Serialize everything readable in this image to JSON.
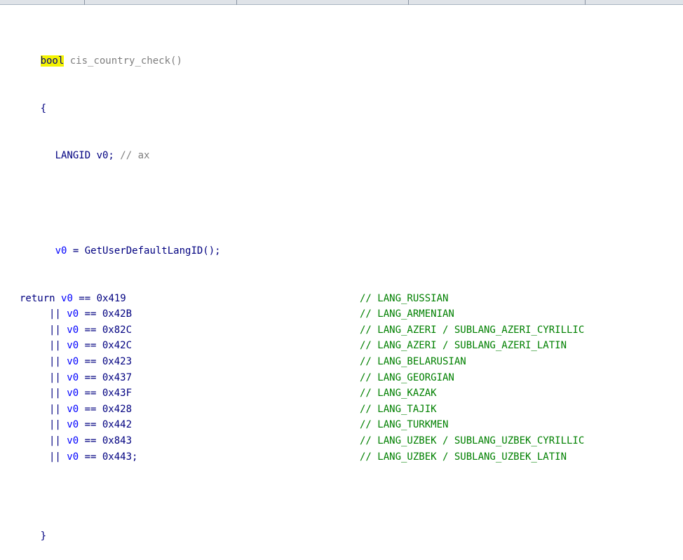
{
  "colors": {
    "code_text": "#000080",
    "comment": "#008000",
    "variable": "#0000ff",
    "signature": "#7f7f7f",
    "highlight": "#f3f300",
    "tab_strip": "#dfe3e8"
  },
  "code": {
    "sig_kw": "bool",
    "sig_rest": " cis_country_check()",
    "open_brace": "{",
    "decl_type": "LANGID v0;",
    "decl_comment": " // ax",
    "assign_var": "v0",
    "assign_rest": " = GetUserDefaultLangID();",
    "ret_kw": "return ",
    "or_op": "||",
    "close_brace": "}",
    "lines": [
      {
        "var": "v0",
        "val": "0x419",
        "comment": "// LANG_RUSSIAN"
      },
      {
        "var": "v0",
        "val": "0x42B",
        "comment": "// LANG_ARMENIAN"
      },
      {
        "var": "v0",
        "val": "0x82C",
        "comment": "// LANG_AZERI / SUBLANG_AZERI_CYRILLIC"
      },
      {
        "var": "v0",
        "val": "0x42C",
        "comment": "// LANG_AZERI / SUBLANG_AZERI_LATIN"
      },
      {
        "var": "v0",
        "val": "0x423",
        "comment": "// LANG_BELARUSIAN"
      },
      {
        "var": "v0",
        "val": "0x437",
        "comment": "// LANG_GEORGIAN"
      },
      {
        "var": "v0",
        "val": "0x43F",
        "comment": "// LANG_KAZAK"
      },
      {
        "var": "v0",
        "val": "0x428",
        "comment": "// LANG_TAJIK"
      },
      {
        "var": "v0",
        "val": "0x442",
        "comment": "// LANG_TURKMEN"
      },
      {
        "var": "v0",
        "val": "0x843",
        "comment": "// LANG_UZBEK / SUBLANG_UZBEK_CYRILLIC"
      },
      {
        "var": "v0",
        "val": "0x443;",
        "comment": "// LANG_UZBEK / SUBLANG_UZBEK_LATIN"
      }
    ],
    "eq_op": " == "
  }
}
